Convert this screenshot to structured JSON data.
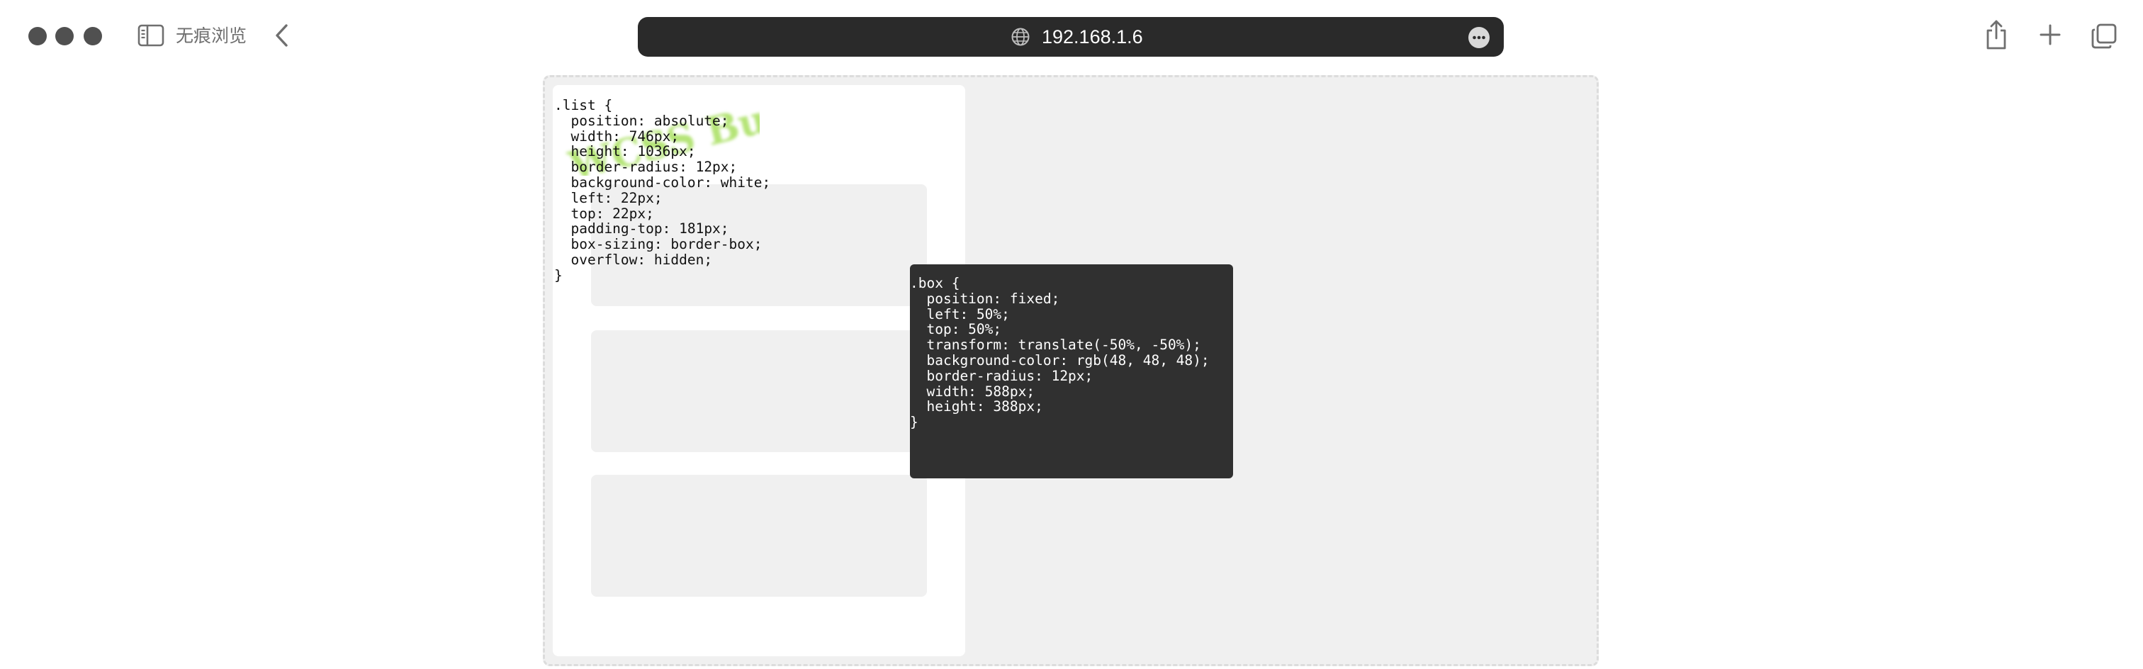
{
  "window": {
    "traffic_lights": [
      "close",
      "minimize",
      "zoom"
    ]
  },
  "toolbar": {
    "private_label": "无痕浏览",
    "url": "192.168.1.6",
    "icons": [
      "sidebar-icon",
      "back-icon",
      "globe-icon",
      "more-icon",
      "share-icon",
      "plus-icon",
      "tabs-icon"
    ]
  },
  "page": {
    "list_code": ".list {\n  position: absolute;\n  width: 746px;\n  height: 1036px;\n  border-radius: 12px;\n  background-color: white;\n  left: 22px;\n  top: 22px;\n  padding-top: 181px;\n  box-sizing: border-box;\n  overflow: hidden;\n}",
    "box_code": ".box {\n  position: fixed;\n  left: 50%;\n  top: 50%;\n  transform: translate(-50%, -50%);\n  background-color: rgb(48, 48, 48);\n  border-radius: 12px;\n  width: 588px;\n  height: 388px;\n}",
    "cards": [
      "card-1",
      "card-2",
      "card-3"
    ],
    "watermark_text": "WCSS Bud"
  },
  "colors": {
    "address_bar": "#2a2a2a",
    "box_bg": "#303030",
    "frame_bg": "#f0f0f0",
    "watermark": "#a8e060"
  }
}
